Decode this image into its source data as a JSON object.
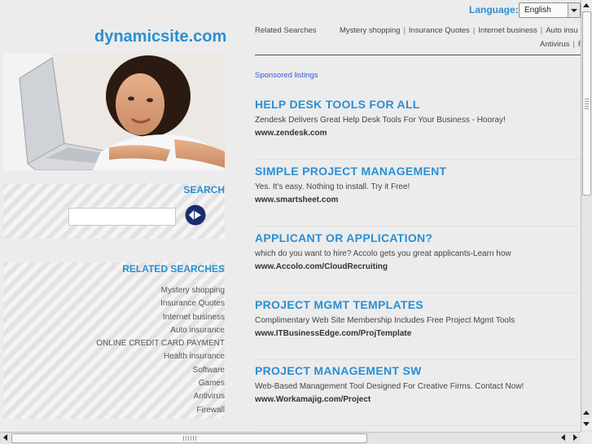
{
  "language": {
    "label": "Language:",
    "selected": "English"
  },
  "site": {
    "name": "dynamicsite.com"
  },
  "search": {
    "title": "SEARCH",
    "placeholder": ""
  },
  "related": {
    "title": "RELATED SEARCHES",
    "items": [
      "Mystery shopping",
      "Insurance Quotes",
      "Internet business",
      "Auto insurance",
      "ONLINE CREDIT CARD PAYMENT",
      "Health insurance",
      "Software",
      "Games",
      "Antivirus",
      "Firewall"
    ]
  },
  "nav": {
    "label": "Related Searches",
    "links": [
      "Mystery shopping",
      "Insurance Quotes",
      "Internet business",
      "Auto insu"
    ],
    "links_row2": [
      "Antivirus",
      "F"
    ]
  },
  "sponsored": "Sponsored listings",
  "ads": [
    {
      "title": "HELP DESK TOOLS FOR ALL",
      "desc": "Zendesk Delivers Great Help Desk Tools For Your Business - Hooray!",
      "url": "www.zendesk.com"
    },
    {
      "title": "SIMPLE PROJECT MANAGEMENT",
      "desc": "Yes. It's easy. Nothing to install. Try it Free!",
      "url": "www.smartsheet.com"
    },
    {
      "title": "APPLICANT OR APPLICATION?",
      "desc": "which do you want to hire? Accolo gets you great applicants-Learn how",
      "url": "www.Accolo.com/CloudRecruiting"
    },
    {
      "title": "PROJECT MGMT TEMPLATES",
      "desc": "Complimentary Web Site Membership Includes Free Project Mgmt Tools",
      "url": "www.ITBusinessEdge.com/ProjTemplate"
    },
    {
      "title": "PROJECT MANAGEMENT SW",
      "desc": "Web-Based Management Tool Designed For Creative Firms. Contact Now!",
      "url": "www.Workamajig.com/Project"
    }
  ],
  "colors": {
    "accent": "#2a8fd4",
    "text": "#444444",
    "sponsored": "#2a5bd4"
  },
  "icons": {
    "search_go": "arrow-circle-icon",
    "hero": "woman-laptop-photo"
  }
}
